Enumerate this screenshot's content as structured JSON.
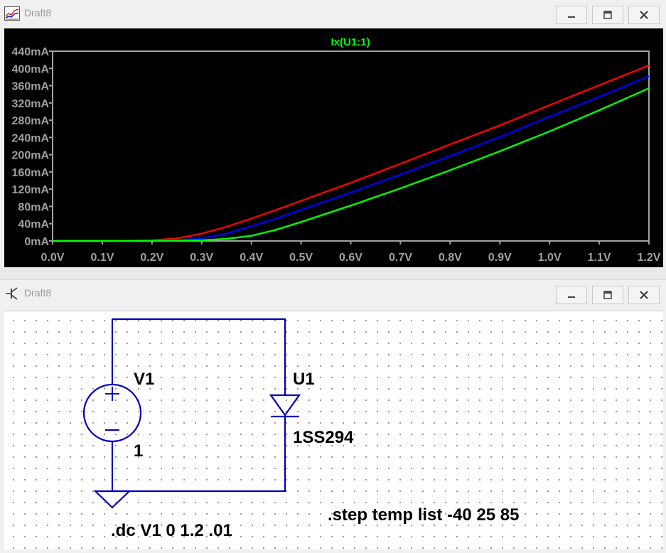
{
  "plot_window": {
    "title": "Draft8",
    "trace_label": "Ix(U1:1)",
    "colors": {
      "background": "#000000",
      "axis": "#a0a0a0",
      "tick_text": "#a0a0a0"
    }
  },
  "schematic_window": {
    "title": "Draft8",
    "source_name": "V1",
    "source_value": "1",
    "diode_name": "U1",
    "diode_model": "1SS294",
    "directive_dc": ".dc V1 0 1.2 .01",
    "directive_step": ".step temp list -40 25 85",
    "wire_color": "#0000c0"
  },
  "chart_data": {
    "type": "line",
    "title": "Ix(U1:1)",
    "xlabel": "",
    "ylabel": "",
    "xlim": [
      0,
      1.2
    ],
    "ylim": [
      0,
      440
    ],
    "x_ticks": [
      "0.0V",
      "0.1V",
      "0.2V",
      "0.3V",
      "0.4V",
      "0.5V",
      "0.6V",
      "0.7V",
      "0.8V",
      "0.9V",
      "1.0V",
      "1.1V",
      "1.2V"
    ],
    "y_ticks": [
      "0mA",
      "40mA",
      "80mA",
      "120mA",
      "160mA",
      "200mA",
      "240mA",
      "280mA",
      "320mA",
      "360mA",
      "400mA",
      "440mA"
    ],
    "x": [
      0,
      0.1,
      0.15,
      0.2,
      0.25,
      0.3,
      0.35,
      0.4,
      0.45,
      0.5,
      0.55,
      0.6,
      0.7,
      0.8,
      0.9,
      1.0,
      1.1,
      1.2
    ],
    "series": [
      {
        "color": "#ff0000",
        "values": [
          0,
          0,
          0.5,
          2,
          6,
          17,
          33,
          52,
          72,
          93,
          114,
          135,
          179,
          224,
          268,
          315,
          361,
          407
        ]
      },
      {
        "color": "#0000ff",
        "values": [
          0,
          0,
          0,
          0.5,
          2,
          6,
          17,
          34,
          52,
          72,
          92,
          112,
          154,
          197,
          241,
          288,
          334,
          382
        ]
      },
      {
        "color": "#00ff00",
        "values": [
          0,
          0,
          0,
          0,
          0.5,
          1.5,
          5,
          12,
          26,
          44,
          63,
          82,
          122,
          164,
          208,
          254,
          303,
          354
        ]
      }
    ]
  }
}
